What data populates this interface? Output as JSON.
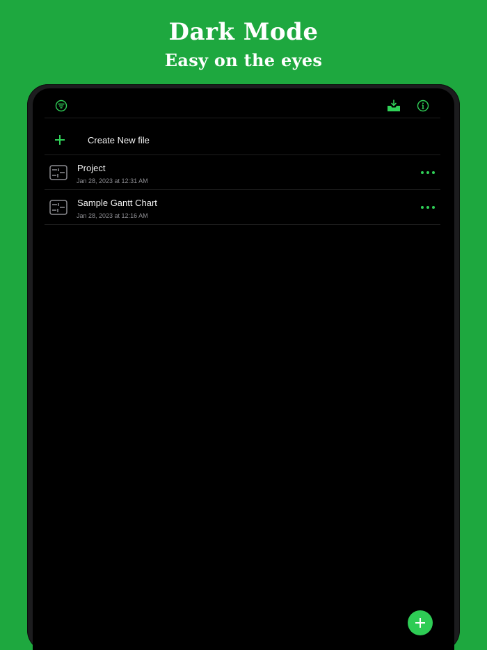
{
  "hero": {
    "title": "Dark Mode",
    "subtitle": "Easy on the eyes"
  },
  "colors": {
    "background": "#1ea83f",
    "accent": "#30d158",
    "screen": "#000000",
    "text_primary": "#f2f2f2",
    "text_secondary": "#8e8e93"
  },
  "toolbar": {
    "left_icons": [
      "filter-icon"
    ],
    "right_icons": [
      "download-tray-icon",
      "info-icon"
    ]
  },
  "create": {
    "icon": "plus-icon",
    "label": "Create New file"
  },
  "files": [
    {
      "icon": "gantt-file-icon",
      "name": "Project",
      "date": "Jan 28, 2023 at 12:31 AM",
      "menu_icon": "more-dots-icon"
    },
    {
      "icon": "gantt-file-icon",
      "name": "Sample Gantt Chart",
      "date": "Jan 28, 2023 at 12:16 AM",
      "menu_icon": "more-dots-icon"
    }
  ],
  "fab": {
    "icon": "plus-icon"
  }
}
